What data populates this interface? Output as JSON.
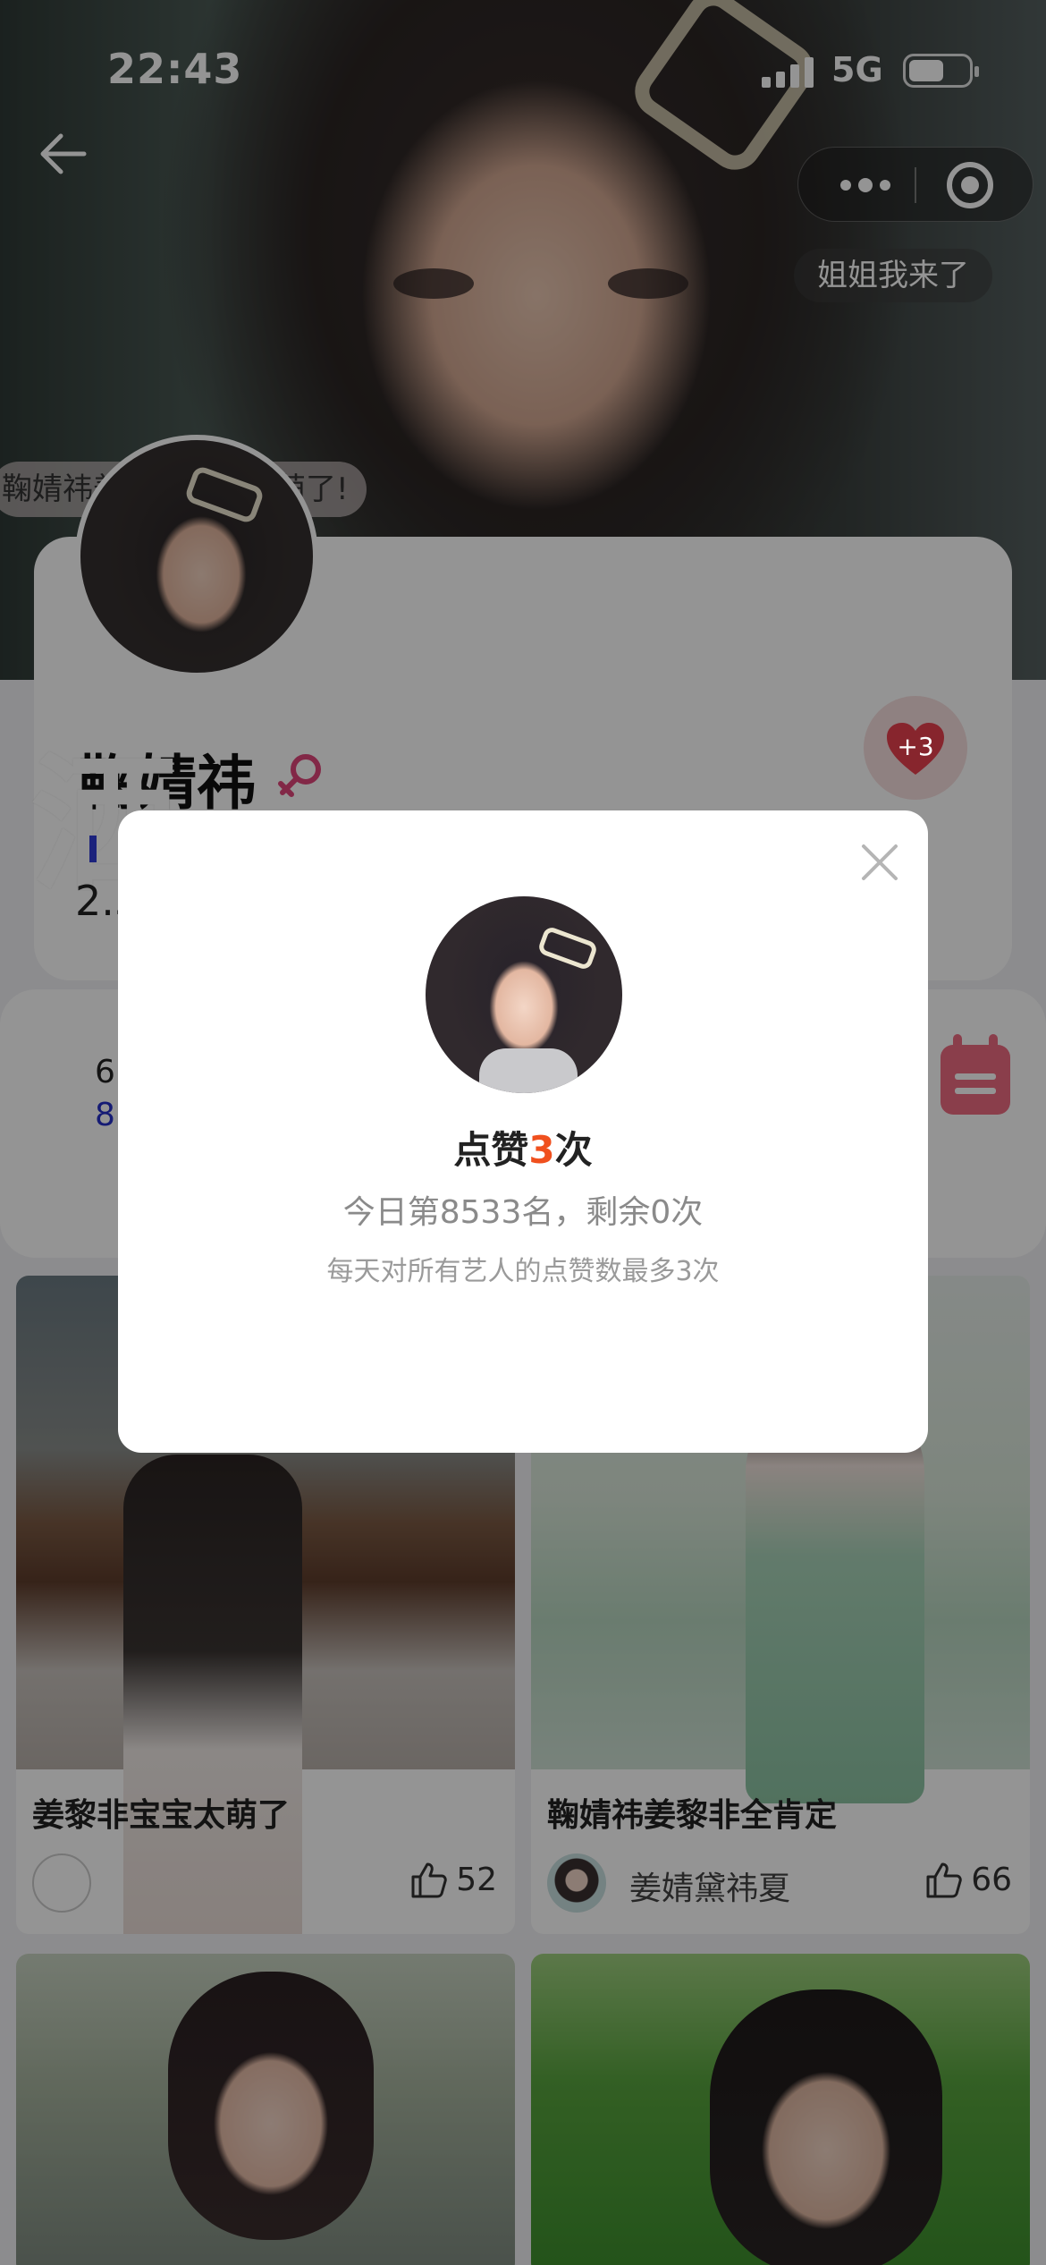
{
  "status_bar": {
    "time": "22:43",
    "network": "5G"
  },
  "hero": {
    "danmu_top": "姐姐我来了",
    "danmu_left": "鞠婧祎姜黎非宝宝太萌了!"
  },
  "profile": {
    "name": "鞠婧祎",
    "big_glyph": "洒",
    "fans_prefix": "2.3",
    "like_badge": "+3"
  },
  "stats": {
    "line1": "6",
    "line2": "8"
  },
  "feed": [
    {
      "title": "姜黎非宝宝太萌了",
      "user": "",
      "likes": "52"
    },
    {
      "title": "鞠婧祎姜黎非全肯定",
      "user": "姜婧黛祎夏",
      "likes": "66"
    },
    {
      "title": "",
      "user": "",
      "likes": ""
    },
    {
      "title": "",
      "user": "",
      "likes": ""
    }
  ],
  "dialog": {
    "title_prefix": "点赞",
    "title_count": "3",
    "title_suffix": "次",
    "rank_text": "今日第8533名，剩余0次",
    "note": "每天对所有艺人的点赞数最多3次"
  },
  "colors": {
    "accent_orange": "#f0501e",
    "heart_red": "#e8404f",
    "female_pink": "#e0467a",
    "calendar_pink": "#ee6b82"
  }
}
